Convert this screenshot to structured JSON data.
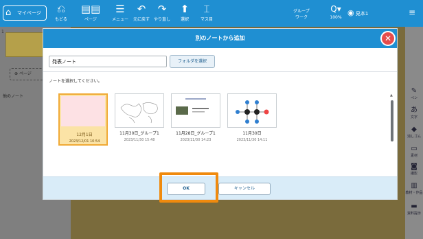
{
  "toolbar": {
    "home_label": "マイページ",
    "buttons": [
      {
        "label": "もどる",
        "icon": "undo-arrow-icon"
      },
      {
        "label": "ページ",
        "icon": "page-icon"
      },
      {
        "label": "メニュー",
        "icon": "menu-icon"
      },
      {
        "label": "元に戻す",
        "icon": "undo-icon"
      },
      {
        "label": "やり直し",
        "icon": "redo-icon"
      },
      {
        "label": "選択",
        "icon": "select-icon"
      },
      {
        "label": "マス目",
        "icon": "grid-icon"
      }
    ],
    "group_label_line1": "グループ",
    "group_label_line2": "ワーク",
    "zoom": "100%",
    "user_name": "見本1"
  },
  "left_panel": {
    "page_number": "1",
    "add_page_label": "ページ",
    "other_note_label": "他のノート"
  },
  "right_tools": [
    {
      "label": "ペン",
      "icon": "pen-icon"
    },
    {
      "label": "文字",
      "icon": "text-icon"
    },
    {
      "label": "消しゴム",
      "icon": "eraser-icon"
    },
    {
      "label": "素材",
      "icon": "material-icon"
    },
    {
      "label": "撮影",
      "icon": "camera-icon"
    },
    {
      "label": "教材・作品",
      "icon": "book-icon"
    },
    {
      "label": "資料提示",
      "icon": "present-icon"
    }
  ],
  "dialog": {
    "title": "別のノートから追加",
    "path_value": "発表ノート",
    "folder_button": "フォルダを選択",
    "prompt": "ノートを選択してください。",
    "notes": [
      {
        "name": "12月1日",
        "date": "2023/12/01 10:54",
        "selected": true
      },
      {
        "name": "11月30日_グループ1",
        "date": "2023/11/30 15:48"
      },
      {
        "name": "11月28日_グループ1",
        "date": "2023/11/30 14:23"
      },
      {
        "name": "11月30日",
        "date": "2023/11/30 14:11"
      }
    ],
    "ok_label": "OK",
    "cancel_label": "キャンセル"
  },
  "colors": {
    "toolbar": "#1f8fd2",
    "close_button": "#e74c4c",
    "highlight": "#f08a0d",
    "selected_bg": "#fbe3a6"
  }
}
